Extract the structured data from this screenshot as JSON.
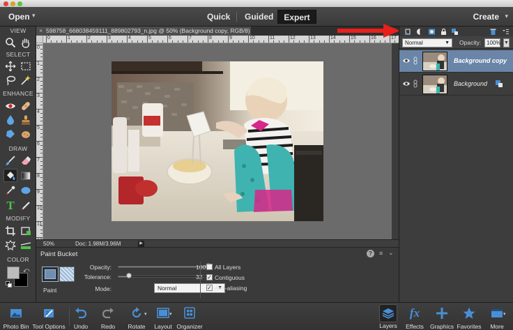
{
  "menubar": {
    "open_label": "Open",
    "modes": [
      {
        "label": "Quick",
        "active": false
      },
      {
        "label": "Guided",
        "active": false
      },
      {
        "label": "Expert",
        "active": true
      }
    ],
    "create_label": "Create"
  },
  "toolbox": {
    "sections": [
      "VIEW",
      "SELECT",
      "ENHANCE",
      "DRAW",
      "MODIFY",
      "COLOR"
    ],
    "tools": [
      {
        "name": "zoom-tool",
        "icon": "magnifier-icon"
      },
      {
        "name": "hand-tool",
        "icon": "hand-icon"
      },
      {
        "name": "move-tool",
        "icon": "move-icon"
      },
      {
        "name": "marquee-tool",
        "icon": "marquee-icon"
      },
      {
        "name": "lasso-tool",
        "icon": "lasso-icon"
      },
      {
        "name": "magic-wand-tool",
        "icon": "magic-wand-icon"
      },
      {
        "name": "red-eye-tool",
        "icon": "eye-icon"
      },
      {
        "name": "spot-healing-tool",
        "icon": "bandage-icon"
      },
      {
        "name": "blur-tool",
        "icon": "drop-icon"
      },
      {
        "name": "clone-stamp-tool",
        "icon": "stamp-icon"
      },
      {
        "name": "sponge-tool",
        "icon": "sponge-icon"
      },
      {
        "name": "brush-tool",
        "icon": "brush-icon"
      },
      {
        "name": "eraser-tool",
        "icon": "eraser-icon"
      },
      {
        "name": "paint-bucket-tool",
        "icon": "paint-bucket-icon",
        "active": true
      },
      {
        "name": "gradient-tool",
        "icon": "gradient-icon"
      },
      {
        "name": "eyedropper-tool",
        "icon": "eyedropper-icon"
      },
      {
        "name": "shape-tool",
        "icon": "ellipse-icon"
      },
      {
        "name": "type-tool",
        "icon": "type-icon"
      },
      {
        "name": "pencil-tool",
        "icon": "pencil-icon"
      },
      {
        "name": "crop-tool",
        "icon": "crop-icon"
      },
      {
        "name": "recompose-tool",
        "icon": "recompose-icon"
      },
      {
        "name": "content-aware-move-tool",
        "icon": "content-move-icon"
      },
      {
        "name": "straighten-tool",
        "icon": "straighten-icon"
      }
    ],
    "type_glyph": "T"
  },
  "document": {
    "close_glyph": "×",
    "tab_title": "598758_668038459111_889802793_n.jpg @ 50% (Background copy, RGB/8) *",
    "ruler_numbers": [
      "0",
      "1",
      "2",
      "3",
      "4",
      "5",
      "6",
      "7",
      "8",
      "9",
      "10",
      "11",
      "12",
      "13",
      "14",
      "15",
      "16",
      "17"
    ],
    "ruler_left_numbers": [
      "0",
      "1",
      "2",
      "3",
      "4",
      "5",
      "6",
      "7",
      "8",
      "9",
      "10",
      "11",
      "12"
    ]
  },
  "status": {
    "zoom": "50%",
    "doc_info": "Doc: 1.98M/3.96M",
    "arrow": "▶"
  },
  "tool_options": {
    "title": "Paint Bucket",
    "help": "?",
    "paint_label": "Paint",
    "opacity_label": "Opacity:",
    "opacity_value": "100%",
    "opacity_fraction": 1.0,
    "tolerance_label": "Tolerance:",
    "tolerance_value": "32",
    "tolerance_fraction": 0.125,
    "mode_label": "Mode:",
    "mode_value": "Normal",
    "checkboxes": [
      {
        "label": "All Layers",
        "checked": false
      },
      {
        "label": "Contiguous",
        "checked": true
      },
      {
        "label": "Anti-aliasing",
        "checked": true
      }
    ],
    "check_glyph": "✓"
  },
  "layers_panel": {
    "blend_mode": "Normal",
    "opacity_label": "Opacity:",
    "opacity_value": "100%",
    "layers": [
      {
        "name": "Background copy",
        "selected": true
      },
      {
        "name": "Background",
        "selected": false
      }
    ]
  },
  "bottombar": {
    "left_items": [
      {
        "label": "Photo Bin",
        "icon": "photo-bin-icon"
      },
      {
        "label": "Tool Options",
        "icon": "tool-options-icon"
      },
      {
        "label": "Undo",
        "icon": "undo-icon"
      },
      {
        "label": "Redo",
        "icon": "redo-icon"
      },
      {
        "label": "Rotate",
        "icon": "rotate-icon"
      },
      {
        "label": "Layout",
        "icon": "layout-icon"
      },
      {
        "label": "Organizer",
        "icon": "organizer-icon"
      }
    ],
    "right_items": [
      {
        "label": "Layers",
        "icon": "layers-icon",
        "active": true
      },
      {
        "label": "Effects",
        "icon": "fx-icon"
      },
      {
        "label": "Graphics",
        "icon": "plus-icon"
      },
      {
        "label": "Favorites",
        "icon": "star-icon"
      },
      {
        "label": "More",
        "icon": "more-icon"
      }
    ],
    "effects_glyph": "fx"
  },
  "colors": {
    "accent_red": "#e8201b",
    "selected_layer": "#6a85a8",
    "active_mode": "#1a1a1a",
    "icon_blue": "#4a8fd6"
  }
}
